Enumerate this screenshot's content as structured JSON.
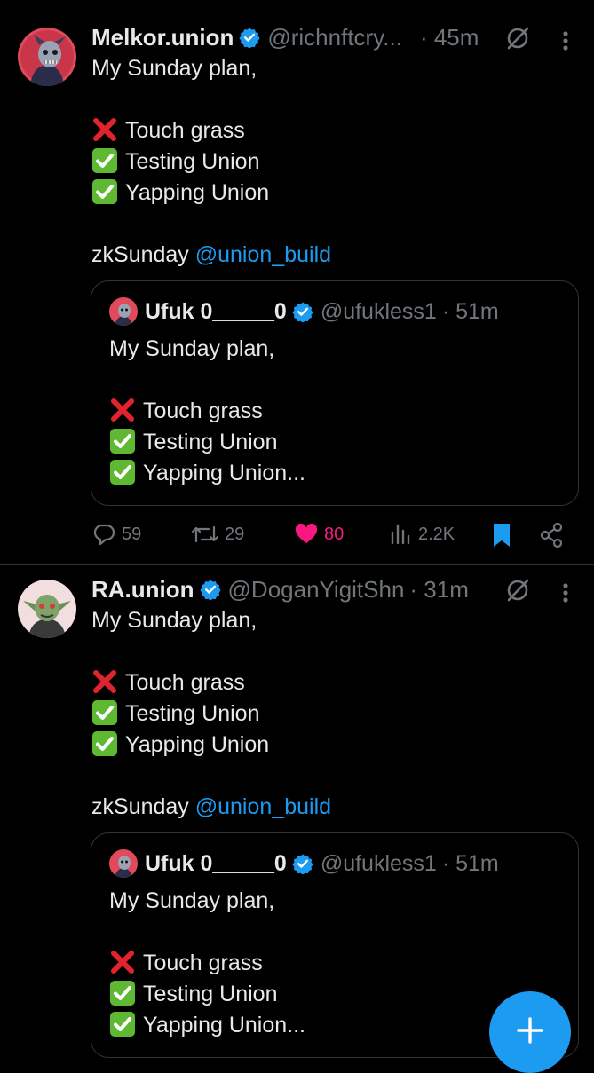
{
  "tweets": [
    {
      "name": "Melkor.union",
      "handle": "@richnftcry...",
      "time": "· 45m",
      "lines": [
        "My Sunday plan,",
        "",
        "Touch grass",
        "Testing Union",
        "Yapping Union",
        "",
        "zkSunday "
      ],
      "mention": "@union_build",
      "quote": {
        "name": "Ufuk 0_____0",
        "handle": "@ufukless1",
        "time": "· 51m",
        "lines": [
          "My Sunday plan,",
          "",
          "Touch grass",
          "Testing Union",
          "Yapping Union..."
        ]
      },
      "stats": {
        "replies": "59",
        "reposts": "29",
        "likes": "80",
        "views": "2.2K"
      }
    },
    {
      "name": "RA.union",
      "handle": "@DoganYigitShn",
      "time": "· 31m",
      "lines": [
        "My Sunday plan,",
        "",
        "Touch grass",
        "Testing Union",
        "Yapping Union",
        "",
        "zkSunday "
      ],
      "mention": "@union_build",
      "quote": {
        "name": "Ufuk 0_____0",
        "handle": "@ufukless1",
        "time": "· 51m",
        "lines": [
          "My Sunday plan,",
          "",
          "Touch grass",
          "Testing Union",
          "Yapping Union..."
        ]
      }
    }
  ],
  "icons": {
    "verified": "verified-badge-icon",
    "cross": "cross-mark-emoji",
    "check": "check-mark-emoji",
    "grok": "grok-icon",
    "more": "more-icon",
    "reply": "reply-icon",
    "repost": "repost-icon",
    "like": "heart-icon",
    "views": "views-icon",
    "bookmark": "bookmark-icon",
    "share": "share-icon",
    "compose": "compose-plus-icon"
  },
  "colors": {
    "background": "#000000",
    "text": "#e7e9ea",
    "muted": "#71767b",
    "accent": "#1d9bf0",
    "like": "#f91880",
    "border": "#2f3336"
  }
}
